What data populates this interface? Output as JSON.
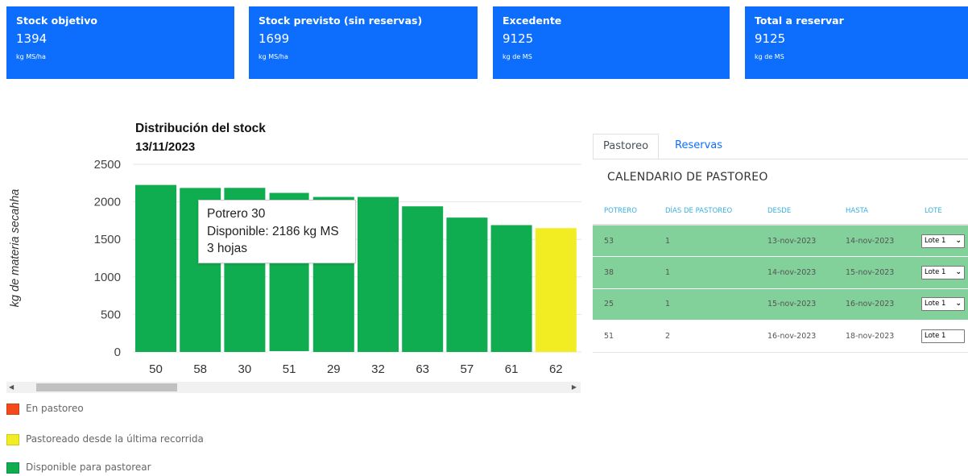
{
  "cards": [
    {
      "title": "Stock objetivo",
      "value": "1394",
      "unit": "kg MS/ha"
    },
    {
      "title": "Stock previsto (sin reservas)",
      "value": "1699",
      "unit": "kg MS/ha"
    },
    {
      "title": "Excedente",
      "value": "9125",
      "unit": "kg de MS"
    },
    {
      "title": "Total a reservar",
      "value": "9125",
      "unit": "kg de MS"
    }
  ],
  "chart_data": {
    "type": "bar",
    "title": "Distribución del stock",
    "subtitle": "13/11/2023",
    "ylabel": "kg de materia secahha",
    "ylim": [
      0,
      2500
    ],
    "yticks": [
      "0",
      "500",
      "1000",
      "1500",
      "2000",
      "2500"
    ],
    "categories": [
      "50",
      "58",
      "30",
      "51",
      "29",
      "32",
      "63",
      "57",
      "61",
      "62"
    ],
    "values": [
      2225,
      2185,
      2186,
      2130,
      2065,
      2065,
      1940,
      1790,
      1690,
      1650
    ],
    "bar_colors": [
      "#0fad4f",
      "#0fad4f",
      "#0fad4f",
      "#0fad4f",
      "#0fad4f",
      "#0fad4f",
      "#0fad4f",
      "#0fad4f",
      "#0fad4f",
      "#f2ec23"
    ],
    "hovered_index": 3
  },
  "tooltip": {
    "line1": "Potrero 30",
    "line2": "Disponible: 2186 kg MS",
    "line3": "3 hojas"
  },
  "scrollbar": {
    "left_arrow": "◀",
    "right_arrow": "▶"
  },
  "legend": [
    {
      "label": "En pastoreo",
      "color": "#f44a1a"
    },
    {
      "label": "Pastoreado desde la última recorrida",
      "color": "#f2ec23"
    },
    {
      "label": "Disponible para pastorear",
      "color": "#0fad4f"
    }
  ],
  "tabs": {
    "active": "Pastoreo",
    "other": "Reservas"
  },
  "calendar": {
    "title": "CALENDARIO DE PASTOREO",
    "headers": [
      "POTRERO",
      "DÍAS DE PASTOREO",
      "DESDE",
      "HASTA",
      "LOTE"
    ],
    "rows": [
      {
        "potrero": "53",
        "dias": "1",
        "desde": "13-nov-2023",
        "hasta": "14-nov-2023",
        "lote": "Lote 1"
      },
      {
        "potrero": "38",
        "dias": "1",
        "desde": "14-nov-2023",
        "hasta": "15-nov-2023",
        "lote": "Lote 1"
      },
      {
        "potrero": "25",
        "dias": "1",
        "desde": "15-nov-2023",
        "hasta": "16-nov-2023",
        "lote": "Lote 1"
      },
      {
        "potrero": "51",
        "dias": "2",
        "desde": "16-nov-2023",
        "hasta": "18-nov-2023",
        "lote": "Lote 1"
      }
    ]
  }
}
